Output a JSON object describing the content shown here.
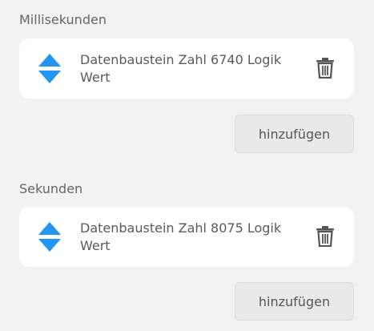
{
  "sections": [
    {
      "label": "Millisekunden",
      "item_text": "Datenbaustein Zahl 6740 Logik Wert",
      "add_label": "hinzufügen"
    },
    {
      "label": "Sekunden",
      "item_text": "Datenbaustein Zahl 8075 Logik Wert",
      "add_label": "hinzufügen"
    }
  ],
  "colors": {
    "accent": "#2196f3",
    "card": "#ffffff",
    "background": "#f2f2f2",
    "button": "#e9e9e9"
  },
  "icons": {
    "sort": "sort-arrows-icon",
    "delete": "trash-icon"
  }
}
